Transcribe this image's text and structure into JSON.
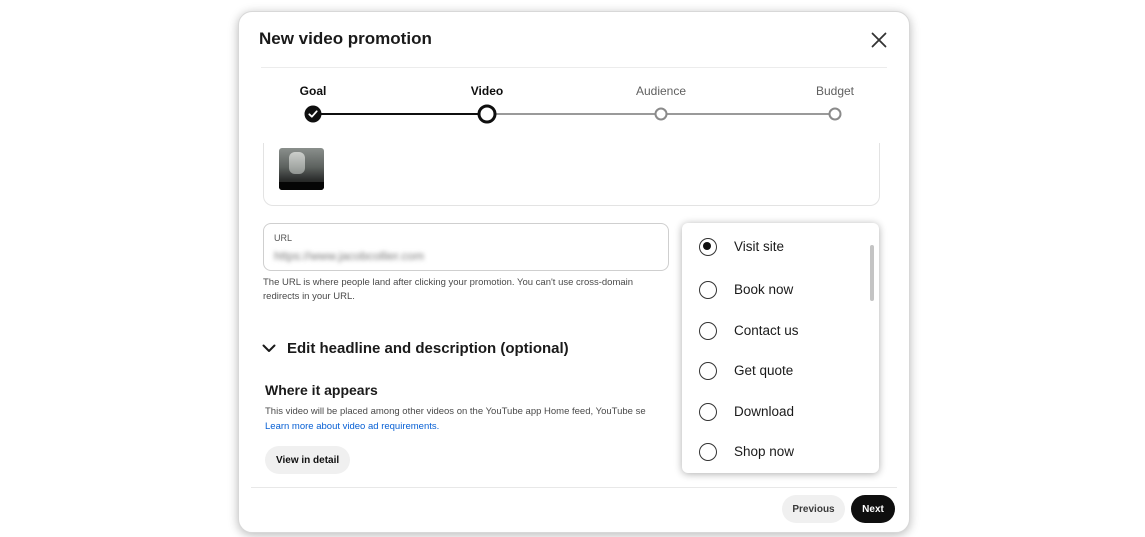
{
  "dialog": {
    "title": "New video promotion"
  },
  "stepper": {
    "steps": [
      {
        "label": "Goal",
        "state": "done"
      },
      {
        "label": "Video",
        "state": "current"
      },
      {
        "label": "Audience",
        "state": "todo"
      },
      {
        "label": "Budget",
        "state": "todo"
      }
    ]
  },
  "url_field": {
    "label": "URL",
    "value": "https://www.jacobcollier.com",
    "help": "The URL is where people land after clicking your promotion. You can't use cross-domain redirects in your URL."
  },
  "edit_section": {
    "label": "Edit headline and description (optional)"
  },
  "where": {
    "title": "Where it appears",
    "description": "This video will be placed among other videos on the YouTube app Home feed, YouTube se",
    "link": "Learn more about video ad requirements.",
    "detail_button": "View in detail"
  },
  "footer": {
    "previous": "Previous",
    "next": "Next"
  },
  "cta_menu": {
    "options": [
      {
        "label": "Visit site",
        "selected": true
      },
      {
        "label": "Book now",
        "selected": false
      },
      {
        "label": "Contact us",
        "selected": false
      },
      {
        "label": "Get quote",
        "selected": false
      },
      {
        "label": "Download",
        "selected": false
      },
      {
        "label": "Shop now",
        "selected": false
      }
    ]
  },
  "colors": {
    "primary_dark": "#0f0f0f",
    "link_blue": "#065fd4",
    "inactive_gray": "#8a8a8a"
  }
}
